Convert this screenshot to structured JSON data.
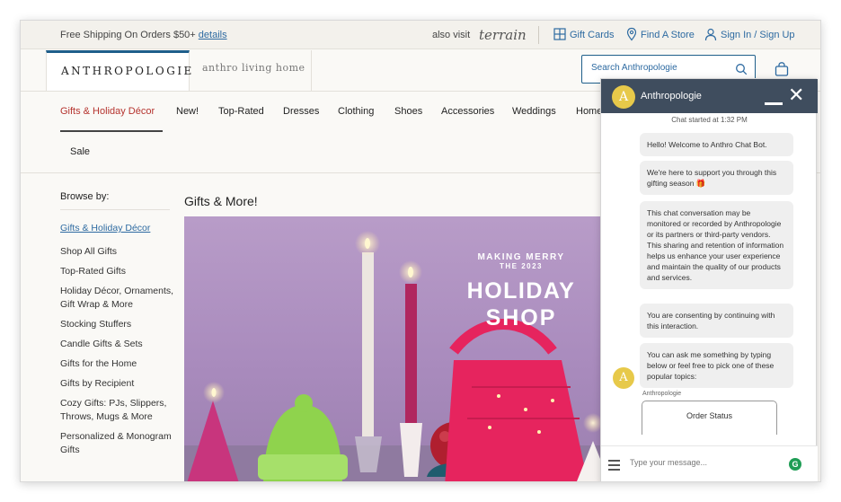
{
  "promo": {
    "shipping_text": "Free Shipping On Orders $50+",
    "details_link": "details",
    "also_visit": "also visit",
    "terrain": "terrain",
    "gift_cards": "Gift Cards",
    "find_store": "Find A Store",
    "sign_in": "Sign In / Sign Up"
  },
  "header": {
    "logo": "ANTHROPOLOGIE",
    "living_home": "anthro living home",
    "search_placeholder": "Search Anthropologie"
  },
  "nav": {
    "items": [
      "Gifts & Holiday Décor",
      "New!",
      "Top-Rated",
      "Dresses",
      "Clothing",
      "Shoes",
      "Accessories",
      "Weddings",
      "Home",
      "Sale"
    ]
  },
  "sidebar": {
    "heading": "Browse by:",
    "current": "Gifts & Holiday Décor",
    "items": [
      "Shop All Gifts",
      "Top-Rated Gifts",
      "Holiday Décor, Ornaments, Gift Wrap & More",
      "Stocking Stuffers",
      "Candle Gifts & Sets",
      "Gifts for the Home",
      "Gifts by Recipient",
      "Cozy Gifts: PJs, Slippers, Throws, Mugs & More",
      "Personalized & Monogram Gifts"
    ]
  },
  "main": {
    "title": "Gifts & More!",
    "hero_small": "MAKING MERRY",
    "hero_year": "THE 2023",
    "hero_line1": "HOLIDAY",
    "hero_line2": "SHOP"
  },
  "chat": {
    "avatar_letter": "A",
    "title": "Anthropologie",
    "started": "Chat started at 1:32 PM",
    "messages": [
      "Hello! Welcome to Anthro Chat Bot.",
      "We're here to support you through this gifting season 🎁",
      "This chat conversation may be monitored or recorded by Anthropologie or its partners or third-party vendors. This sharing and retention of information helps us enhance your user experience and maintain the quality of our products and services.",
      "You are consenting by continuing with this interaction.",
      "You can ask me something by typing below or feel free to pick one of these popular topics:"
    ],
    "sender_label": "Anthropologie",
    "option_1": "Order Status",
    "input_placeholder": "Type your message...",
    "g_badge": "G"
  },
  "colors": {
    "accent_blue": "#2d6aa1",
    "nav_active_red": "#b5332e",
    "chat_header": "#3f4d5e",
    "avatar_yellow": "#e7c94a"
  }
}
